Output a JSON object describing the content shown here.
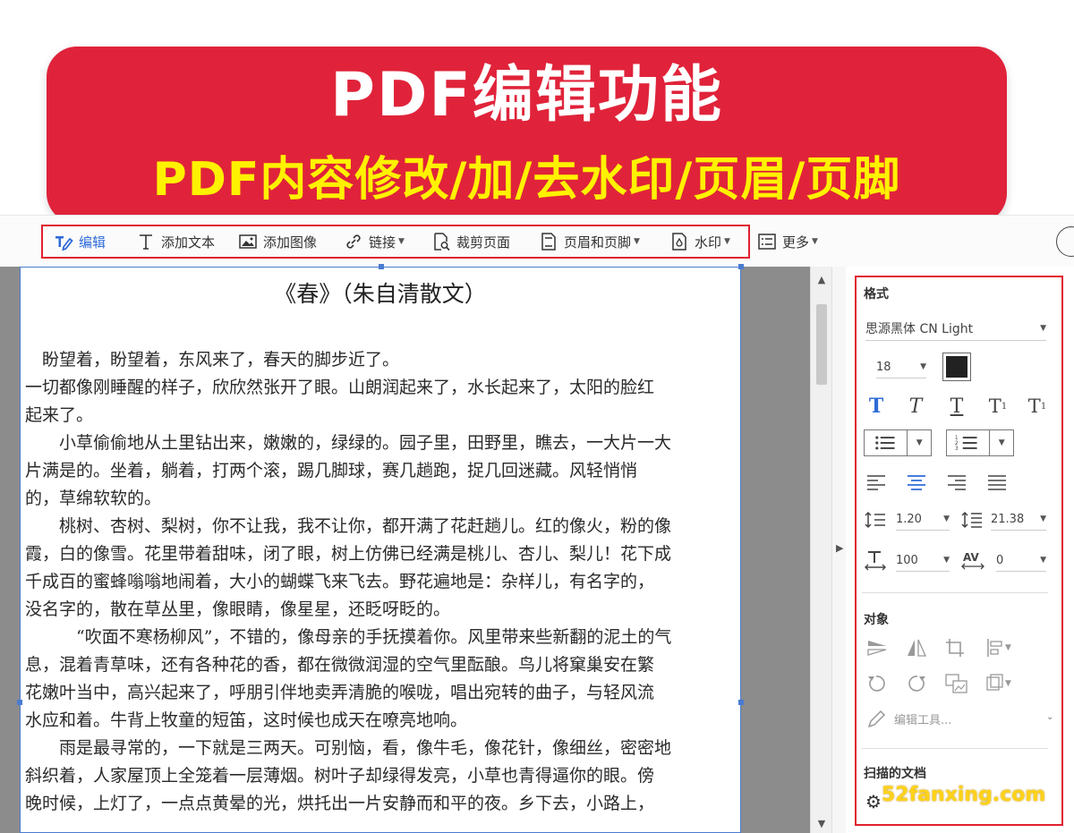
{
  "banner": {
    "title": "PDF编辑功能",
    "subtitle": "PDF内容修改/加/去水印/页眉/页脚"
  },
  "toolbar": {
    "items": [
      {
        "label": "编辑",
        "icon": "edit-icon",
        "active": true
      },
      {
        "label": "添加文本",
        "icon": "text-icon"
      },
      {
        "label": "添加图像",
        "icon": "image-icon"
      },
      {
        "label": "链接",
        "icon": "link-icon",
        "dropdown": true
      },
      {
        "label": "裁剪页面",
        "icon": "crop-page-icon"
      },
      {
        "label": "页眉和页脚",
        "icon": "header-footer-icon",
        "dropdown": true
      },
      {
        "label": "水印",
        "icon": "watermark-icon",
        "dropdown": true
      },
      {
        "label": "更多",
        "icon": "more-icon",
        "dropdown": true
      }
    ]
  },
  "document": {
    "title": "《春》（朱自清散文）",
    "lines": [
      "　盼望着，盼望着，东风来了，春天的脚步近了。",
      "一切都像刚睡醒的样子，欣欣然张开了眼。山朗润起来了，水长起来了，太阳的脸红",
      "起来了。",
      "　　小草偷偷地从土里钻出来，嫩嫩的，绿绿的。园子里，田野里，瞧去，一大片一大",
      "片满是的。坐着，躺着，打两个滚，踢几脚球，赛几趟跑，捉几回迷藏。风轻悄悄",
      "的，草绵软软的。",
      "　　桃树、杏树、梨树，你不让我，我不让你，都开满了花赶趟儿。红的像火，粉的像",
      "霞，白的像雪。花里带着甜味，闭了眼，树上仿佛已经满是桃儿、杏儿、梨儿！花下成",
      "千成百的蜜蜂嗡嗡地闹着，大小的蝴蝶飞来飞去。野花遍地是：杂样儿，有名字的，",
      "没名字的，散在草丛里，像眼睛，像星星，还眨呀眨的。",
      "　　　“吹面不寒杨柳风”，不错的，像母亲的手抚摸着你。风里带来些新翻的泥土的气",
      "息，混着青草味，还有各种花的香，都在微微润湿的空气里酝酿。鸟儿将窠巢安在繁",
      "花嫩叶当中，高兴起来了，呼朋引伴地卖弄清脆的喉咙，唱出宛转的曲子，与轻风流",
      "水应和着。牛背上牧童的短笛，这时候也成天在嘹亮地响。",
      "　　雨是最寻常的，一下就是三两天。可别恼，看，像牛毛，像花针，像细丝，密密地",
      "斜织着，人家屋顶上全笼着一层薄烟。树叶子却绿得发亮，小草也青得逼你的眼。傍",
      "晚时候，上灯了，一点点黄晕的光，烘托出一片安静而和平的夜。乡下去，小路上，"
    ]
  },
  "panel": {
    "format_label": "格式",
    "font_name": "思源黑体 CN Light",
    "font_size": "18",
    "text_color": "#222222",
    "line_spacing": "1.20",
    "para_spacing": "21.38",
    "h_scale": "100",
    "char_spacing": "0",
    "object_label": "对象",
    "edit_tool_label": "编辑工具...",
    "scanned_label": "扫描的文档"
  },
  "watermark": "52fanxing.com",
  "colors": {
    "banner_red": "#e0233a",
    "banner_yellow": "#fff200",
    "accent_blue": "#2f6bd8",
    "highlight_red": "#e02030"
  }
}
